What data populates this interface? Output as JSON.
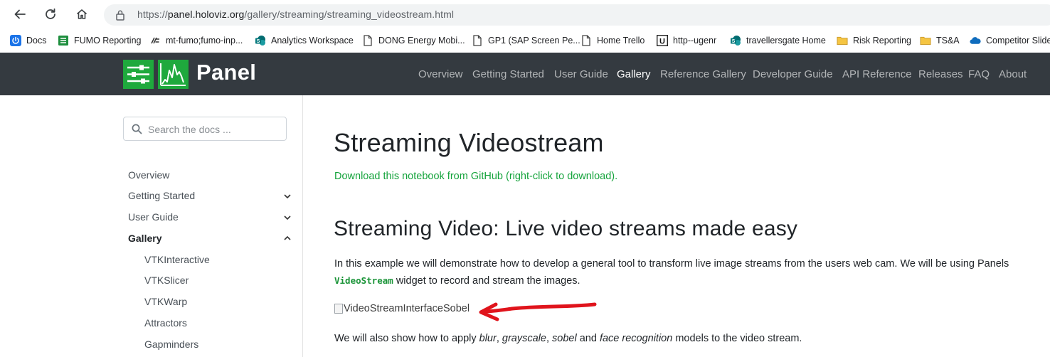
{
  "browser": {
    "url_prefix": "https://",
    "url_host": "panel.holoviz.org",
    "url_path": "/gallery/streaming/streaming_videostream.html"
  },
  "bookmarks": [
    {
      "label": "Docs",
      "icon": "power-icon"
    },
    {
      "label": "FUMO Reporting",
      "icon": "sheet-icon"
    },
    {
      "label": "mt-fumo;fumo-inp...",
      "icon": "link-icon"
    },
    {
      "label": "Analytics Workspace",
      "icon": "sharepoint-icon"
    },
    {
      "label": "DONG Energy Mobi...",
      "icon": "page-icon"
    },
    {
      "label": "GP1 (SAP Screen Pe...",
      "icon": "page-icon"
    },
    {
      "label": "Home  Trello",
      "icon": "page-icon"
    },
    {
      "label": "http--ugenr",
      "icon": "u-icon"
    },
    {
      "label": "travellersgate  Home",
      "icon": "sharepoint-icon"
    },
    {
      "label": "Risk Reporting",
      "icon": "folder-icon"
    },
    {
      "label": "TS&A",
      "icon": "folder-icon"
    },
    {
      "label": "Competitor Slide",
      "icon": "cloud-icon"
    }
  ],
  "navbar": {
    "brand": "Panel",
    "links": [
      "Overview",
      "Getting Started",
      "User Guide",
      "Gallery",
      "Reference Gallery",
      "Developer Guide",
      "API Reference",
      "Releases",
      "FAQ",
      "About"
    ],
    "active": "Gallery"
  },
  "sidebar": {
    "search_placeholder": "Search the docs ...",
    "items": [
      {
        "label": "Overview"
      },
      {
        "label": "Getting Started"
      },
      {
        "label": "User Guide"
      },
      {
        "label": "Gallery"
      },
      {
        "label": "VTKInteractive"
      },
      {
        "label": "VTKSlicer"
      },
      {
        "label": "VTKWarp"
      },
      {
        "label": "Attractors"
      },
      {
        "label": "Gapminders"
      }
    ]
  },
  "main": {
    "title": "Streaming Videostream",
    "download_link": "Download this notebook from GitHub (right-click to download).",
    "subtitle": "Streaming Video: Live video streams made easy",
    "para1_a": "In this example we will demonstrate how to develop a general tool to transform live image streams from the users web cam. We will be using Panels",
    "para1_code": "VideoStream",
    "para1_b": " widget to record and stream the images.",
    "image_alt": "VideoStreamInterfaceSobel",
    "para2_a": "We will also show how to apply ",
    "para2_blur": "blur",
    "para2_comma1": ", ",
    "para2_gray": "grayscale",
    "para2_comma2": ", ",
    "para2_sobel": "sobel",
    "para2_and": " and ",
    "para2_face": "face recognition",
    "para2_b": " models to the video stream."
  },
  "colors": {
    "accent_green": "#14a33b",
    "navbar_bg": "#343a40",
    "annotation_red": "#e0141c"
  }
}
